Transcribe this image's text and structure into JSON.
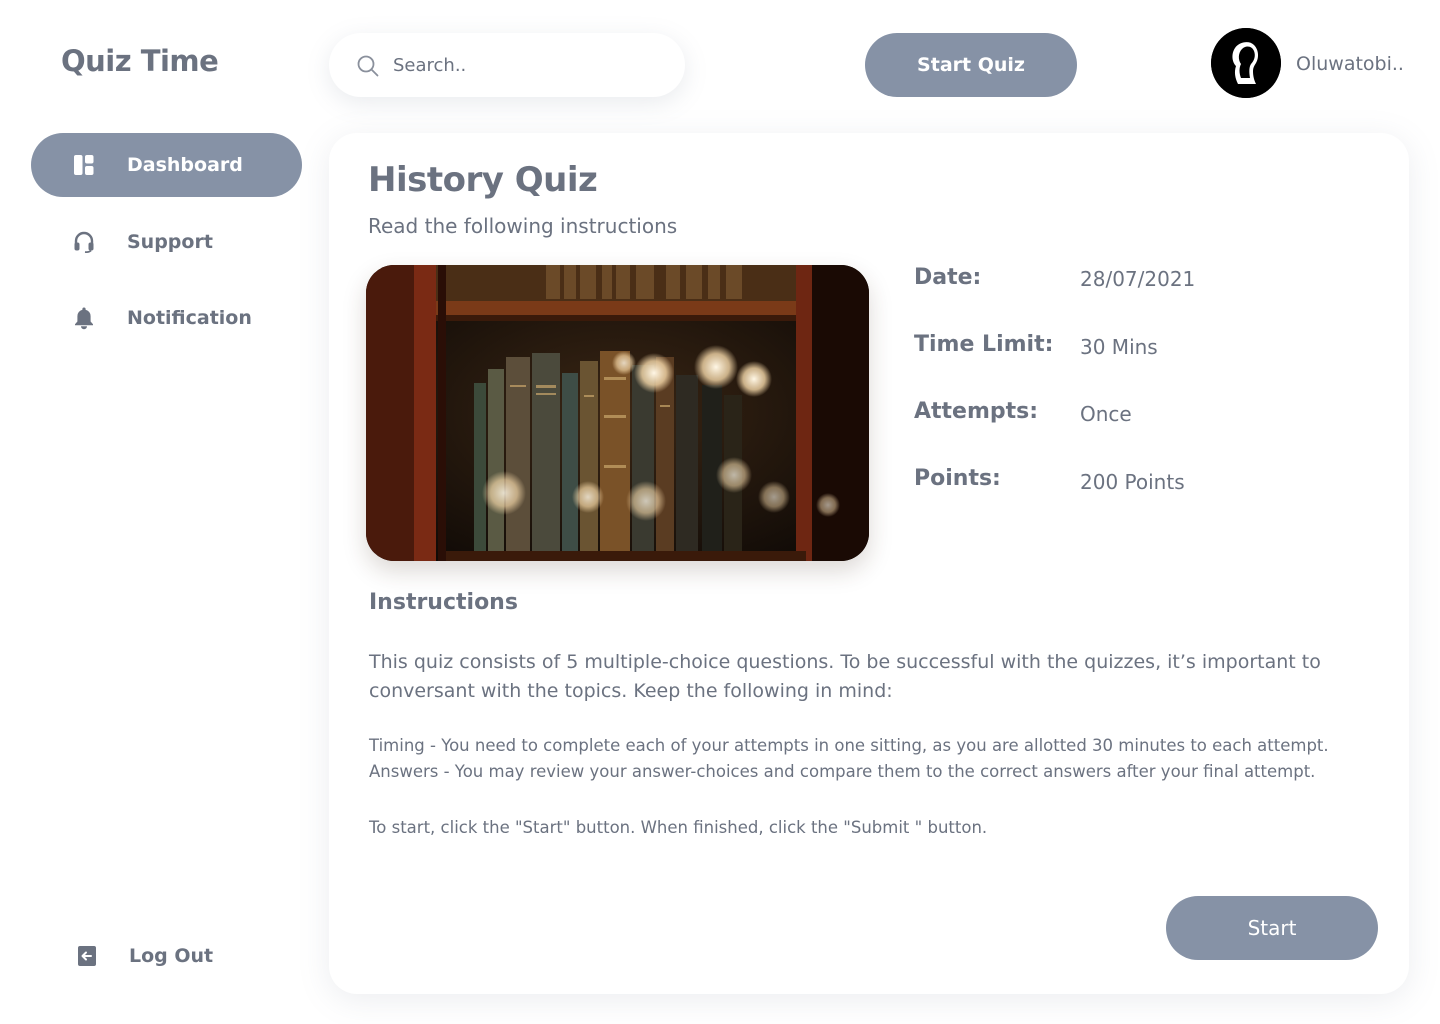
{
  "app": {
    "title": "Quiz Time"
  },
  "sidebar": {
    "items": [
      {
        "label": "Dashboard",
        "icon": "dashboard-icon",
        "active": true
      },
      {
        "label": "Support",
        "icon": "headset-icon",
        "active": false
      },
      {
        "label": "Notification",
        "icon": "bell-icon",
        "active": false
      }
    ],
    "logout": {
      "label": "Log Out",
      "icon": "logout-icon"
    }
  },
  "header": {
    "search": {
      "placeholder": "Search..",
      "value": "",
      "icon": "search-icon"
    },
    "start_quiz_label": "Start Quiz",
    "user": {
      "name": "Oluwatobi..",
      "avatar_icon": "user-silhouette-icon"
    }
  },
  "quiz": {
    "title": "History Quiz",
    "subtitle": "Read the following instructions",
    "details": [
      {
        "label": "Date:",
        "value": "28/07/2021"
      },
      {
        "label": "Time Limit:",
        "value": "30 Mins"
      },
      {
        "label": "Attempts:",
        "value": "Once"
      },
      {
        "label": "Points:",
        "value": "200 Points"
      }
    ],
    "instructions": {
      "heading": "Instructions",
      "intro": "This quiz consists of 5 multiple-choice questions. To be successful with the quizzes, it’s important to conversant with the topics. Keep the following in mind:",
      "rules": [
        "Timing - You need to complete each of your attempts in one sitting, as you are allotted 30 minutes to each attempt.",
        "Answers - You may review your answer-choices and compare them to the correct answers after your final attempt."
      ],
      "footer": "To start, click the \"Start\" button. When finished, click the \"Submit \" button."
    },
    "start_label": "Start"
  },
  "colors": {
    "accent": "#8692a6",
    "text": "#6b7280",
    "background": "#ffffff"
  }
}
